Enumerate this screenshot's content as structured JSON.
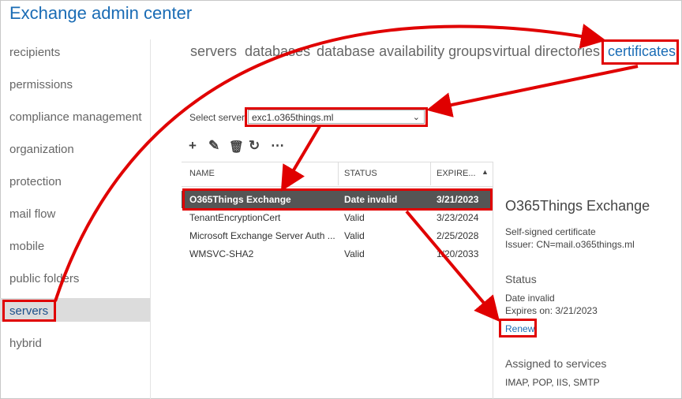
{
  "app_title": "Exchange admin center",
  "nav": [
    "recipients",
    "permissions",
    "compliance management",
    "organization",
    "protection",
    "mail flow",
    "mobile",
    "public folders",
    "servers",
    "hybrid"
  ],
  "tabs": [
    "servers",
    "databases",
    "database availability groups",
    "virtual directories",
    "certificates"
  ],
  "select": {
    "label": "Select server:",
    "value": "exc1.o365things.ml"
  },
  "toolbar": [
    "add-icon",
    "edit-icon",
    "delete-icon",
    "refresh-icon",
    "more-icon"
  ],
  "columns": {
    "name": "NAME",
    "status": "STATUS",
    "expires": "EXPIRE..."
  },
  "rows": [
    {
      "name": "O365Things Exchange",
      "status": "Date invalid",
      "expires": "3/21/2023"
    },
    {
      "name": "TenantEncryptionCert",
      "status": "Valid",
      "expires": "3/23/2024"
    },
    {
      "name": "Microsoft Exchange Server Auth ...",
      "status": "Valid",
      "expires": "2/25/2028"
    },
    {
      "name": "WMSVC-SHA2",
      "status": "Valid",
      "expires": "1/20/2033"
    }
  ],
  "detail": {
    "title": "O365Things Exchange",
    "type": "Self-signed certificate",
    "issuer": "Issuer: CN=mail.o365things.ml",
    "status_heading": "Status",
    "status_value": "Date invalid",
    "expires": "Expires on: 3/21/2023",
    "renew": "Renew",
    "services_heading": "Assigned to services",
    "services": "IMAP, POP, IIS, SMTP"
  },
  "colors": {
    "accent": "#1a6cb5",
    "highlight": "#e00000",
    "selected_row": "#555555"
  }
}
